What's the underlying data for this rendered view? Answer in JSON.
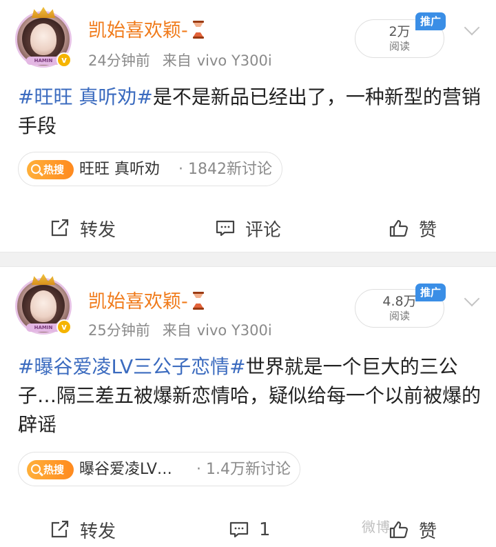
{
  "posts": [
    {
      "author": "凯始喜欢颖-",
      "time": "24分钟前",
      "source_prefix": "来自",
      "source_device": "vivo Y300i",
      "reads": "2万",
      "reads_label": "阅读",
      "promo_label": "推广",
      "text_tag": "#旺旺 真听劝#",
      "text_body": "是不是新品已经出了，一种新型的营销手段",
      "hot_badge": "热搜",
      "hot_title": "旺旺 真听劝",
      "hot_count": "· 1842新讨论",
      "actions": {
        "repost": "转发",
        "comment": "评论",
        "like": "赞"
      }
    },
    {
      "author": "凯始喜欢颖-",
      "time": "25分钟前",
      "source_prefix": "来自",
      "source_device": "vivo Y300i",
      "reads": "4.8万",
      "reads_label": "阅读",
      "promo_label": "推广",
      "text_tag": "#曝谷爱凌LV三公子恋情#",
      "text_body": "世界就是一个巨大的三公子…隔三差五被爆新恋情哈，疑似给每一个以前被爆的辟谣",
      "hot_badge": "热搜",
      "hot_title": "曝谷爱凌LV…",
      "hot_count": "· 1.4万新讨论",
      "actions": {
        "repost": "转发",
        "comment": "1",
        "like": "赞"
      }
    }
  ],
  "avatar_banner": "HAMIN",
  "verified_mark": "v",
  "watermark": "微博"
}
